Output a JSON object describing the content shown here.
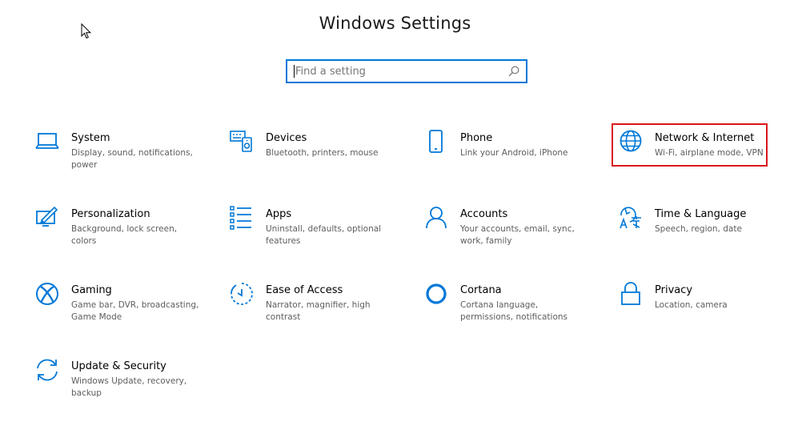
{
  "window": {
    "title": "Windows Settings"
  },
  "search": {
    "placeholder": "Find a setting"
  },
  "tiles": [
    {
      "id": "system",
      "label": "System",
      "description": "Display, sound, notifications, power",
      "icon": "laptop-icon"
    },
    {
      "id": "devices",
      "label": "Devices",
      "description": "Bluetooth, printers, mouse",
      "icon": "keyboard-speaker-icon"
    },
    {
      "id": "phone",
      "label": "Phone",
      "description": "Link your Android, iPhone",
      "icon": "phone-icon"
    },
    {
      "id": "network",
      "label": "Network & Internet",
      "description": "Wi-Fi, airplane mode, VPN",
      "icon": "globe-icon"
    },
    {
      "id": "personalization",
      "label": "Personalization",
      "description": "Background, lock screen, colors",
      "icon": "paint-icon"
    },
    {
      "id": "apps",
      "label": "Apps",
      "description": "Uninstall, defaults, optional features",
      "icon": "apps-list-icon"
    },
    {
      "id": "accounts",
      "label": "Accounts",
      "description": "Your accounts, email, sync, work, family",
      "icon": "person-icon"
    },
    {
      "id": "time-language",
      "label": "Time & Language",
      "description": "Speech, region, date",
      "icon": "language-icon"
    },
    {
      "id": "gaming",
      "label": "Gaming",
      "description": "Game bar, DVR, broadcasting, Game Mode",
      "icon": "xbox-icon"
    },
    {
      "id": "ease-of-access",
      "label": "Ease of Access",
      "description": "Narrator, magnifier, high contrast",
      "icon": "ease-of-access-icon"
    },
    {
      "id": "cortana",
      "label": "Cortana",
      "description": "Cortana language, permissions, notifications",
      "icon": "cortana-circle-icon"
    },
    {
      "id": "privacy",
      "label": "Privacy",
      "description": "Location, camera",
      "icon": "lock-icon"
    },
    {
      "id": "update-security",
      "label": "Update & Security",
      "description": "Windows Update, recovery, backup",
      "icon": "sync-arrows-icon"
    }
  ],
  "colors": {
    "accent": "#0078d7",
    "highlight": "#d9161c",
    "description_text": "#5d5d5d"
  }
}
